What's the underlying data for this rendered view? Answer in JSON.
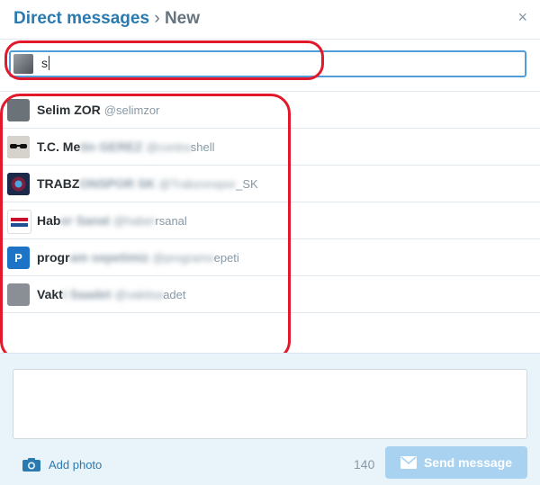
{
  "header": {
    "title_link": "Direct messages",
    "separator": "›",
    "title_current": "New",
    "close_glyph": "×"
  },
  "search": {
    "value": "s"
  },
  "results": [
    {
      "name": "Selim ZOR",
      "name_blur": "",
      "handle": "@selimzor",
      "handle_blur": "",
      "handle_tail": "",
      "avatar": "person-photo-avatar",
      "avatar_color": "#6b7278"
    },
    {
      "name": "T.C. Me",
      "name_blur": "tin GEREZ",
      "handle": "",
      "handle_blur": "@contra",
      "handle_tail": "shell",
      "avatar": "sunglasses-avatar",
      "avatar_color": "#3a3a3a"
    },
    {
      "name": "TRABZ",
      "name_blur": "ONSPOR SK",
      "handle": "",
      "handle_blur": "@Trabzonspor",
      "handle_tail": "_SK",
      "avatar": "club-crest-avatar",
      "avatar_color": "#7a1f3d"
    },
    {
      "name": "Hab",
      "name_blur": "er Sanal",
      "handle": "",
      "handle_blur": "@haber",
      "handle_tail": "rsanal",
      "avatar": "news-logo-avatar",
      "avatar_color": "#ffffff"
    },
    {
      "name": "progr",
      "name_blur": "am sepetimiz",
      "handle": "",
      "handle_blur": "@programs",
      "handle_tail": "epeti",
      "avatar": "p-logo-avatar",
      "avatar_color": "#1d74c6"
    },
    {
      "name": "Vakt",
      "name_blur": "i Saadet",
      "handle": "",
      "handle_blur": "@vakitsa",
      "handle_tail": "adet",
      "avatar": "person-portrait-avatar",
      "avatar_color": "#8a8f96"
    }
  ],
  "composer": {
    "add_photo_label": "Add photo",
    "char_count": "140",
    "send_label": "Send message"
  },
  "colors": {
    "accent": "#2a7ab0",
    "highlight_annotation": "#e4182b",
    "send_disabled": "#a9d2f0"
  }
}
